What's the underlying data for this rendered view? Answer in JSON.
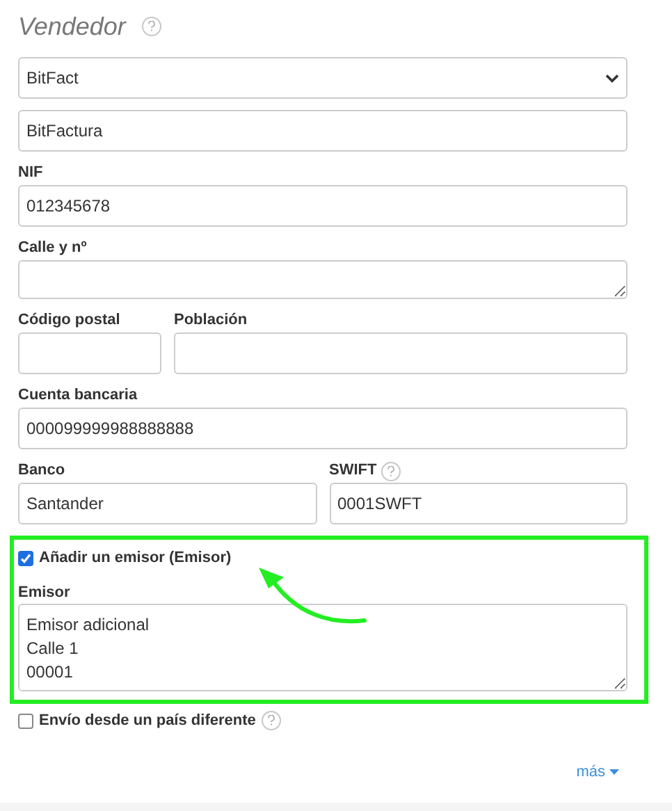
{
  "title": "Vendedor",
  "rows": [
    [
      {
        "kind": "select",
        "value": "BitFact"
      }
    ],
    [
      {
        "kind": "input",
        "value": "BitFactura"
      }
    ],
    [
      {
        "kind": "input",
        "label": "NIF",
        "value": "012345678"
      }
    ],
    [
      {
        "kind": "textarea",
        "label": "Calle y nº"
      }
    ],
    [
      {
        "kind": "input",
        "label": "Código postal",
        "narrow": true
      },
      {
        "kind": "input",
        "label": "Población"
      }
    ],
    [
      {
        "kind": "input",
        "label": "Cuenta bancaria",
        "value": "000099999988888888"
      }
    ],
    [
      {
        "kind": "input",
        "label": "Banco",
        "value": "Santander"
      },
      {
        "kind": "input",
        "label": "SWIFT",
        "help": true,
        "value": "0001SWFT"
      }
    ]
  ],
  "issuer": {
    "checkbox": {
      "label": "Añadir un emisor (Emisor)",
      "checked": true
    },
    "label": "Emisor",
    "value": "Emisor adicional\nCalle 1\n00001"
  },
  "other_country": {
    "label": "Envío desde un país diferente",
    "checked": false,
    "help": true
  },
  "more_link": "más"
}
